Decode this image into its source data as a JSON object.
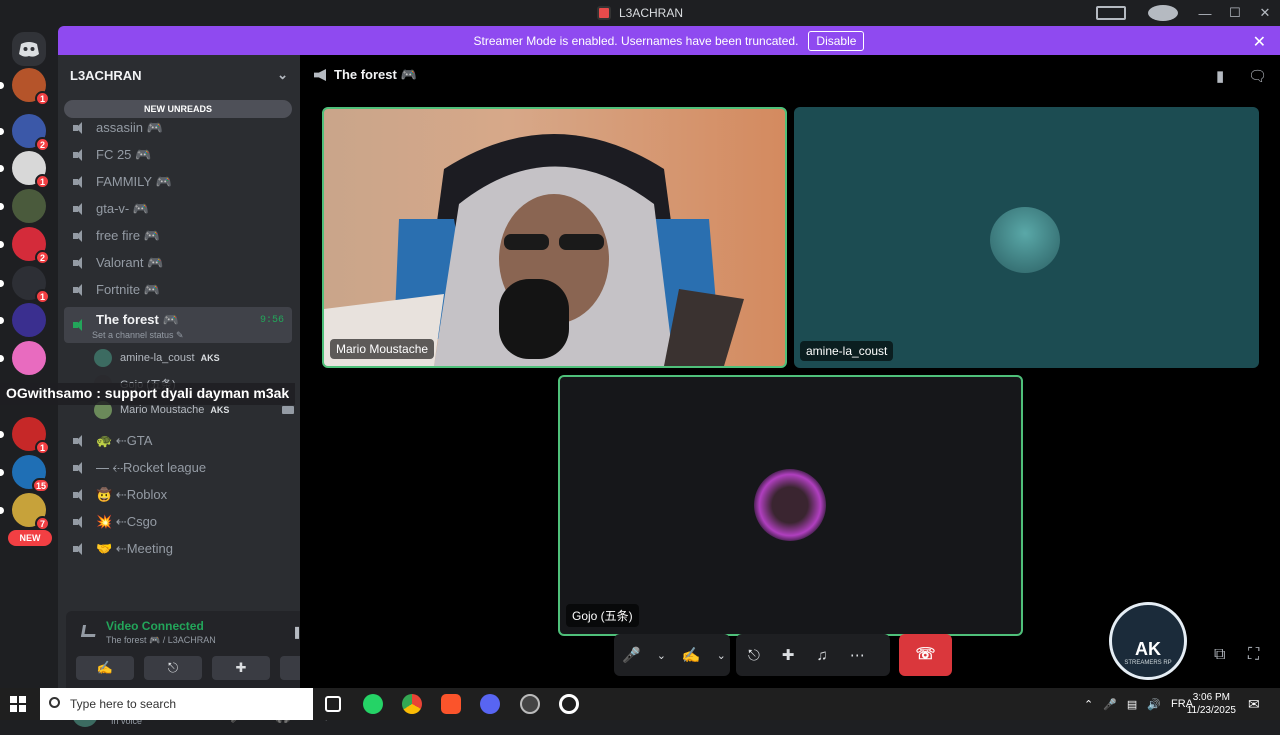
{
  "window": {
    "title": "L3ACHRAN"
  },
  "banner": {
    "text": "Streamer Mode is enabled. Usernames have been truncated.",
    "disable_label": "Disable"
  },
  "servers": [
    {
      "badge": "1",
      "color": "#b5542a"
    },
    {
      "badge": "2",
      "color": "#3b58a8"
    },
    {
      "badge": "1",
      "color": "#d8d8d8"
    },
    {
      "badge": "",
      "color": "#4a5a3c"
    },
    {
      "badge": "2",
      "color": "#d42b3a"
    },
    {
      "badge": "1",
      "color": "#2d2f35"
    },
    {
      "badge": "",
      "color": "#3a2f8f"
    },
    {
      "badge": "",
      "color": "#e86bbf"
    },
    {
      "badge": "1",
      "color": "#c62828"
    },
    {
      "badge": "15",
      "color": "#1f6fb5"
    },
    {
      "badge": "7",
      "color": "#c7a23a"
    }
  ],
  "new_label": "NEW",
  "sidebar": {
    "guild_name": "L3ACHRAN",
    "new_unreads": "NEW UNREADS",
    "channels": [
      {
        "name": "assasiin 🎮"
      },
      {
        "name": "FC 25 🎮"
      },
      {
        "name": "FAMMILY 🎮"
      },
      {
        "name": "gta-v- 🎮"
      },
      {
        "name": "free fire 🎮"
      },
      {
        "name": "Valorant 🎮"
      },
      {
        "name": "Fortnite 🎮"
      }
    ],
    "active_channel": {
      "name": "The forest 🎮",
      "timer": "9:56",
      "status": "Set a channel status ✎"
    },
    "members": [
      {
        "name": "amine-la_coust",
        "tag": "AKS"
      },
      {
        "name": "Gojo (五条)",
        "tag": ""
      },
      {
        "name": "Mario Moustache",
        "tag": "AKS"
      }
    ],
    "more_channels": [
      {
        "name": "🐢 ⇠GTA"
      },
      {
        "name": "⎯⎯ ⇠Rocket league"
      },
      {
        "name": "🤠 ⇠Roblox"
      },
      {
        "name": "💥 ⇠Csgo"
      },
      {
        "name": "🤝 ⇠Meeting"
      }
    ]
  },
  "overlay_message": "OGwithsamo : support dyali dayman m3ak",
  "voice_panel": {
    "title": "Video Connected",
    "subtitle": "The forest 🎮 / L3ACHRAN"
  },
  "user": {
    "name": "amine-la_coust",
    "status": "In voice"
  },
  "stage": {
    "channel_name": "The forest 🎮",
    "tiles": [
      {
        "label": "Mario Moustache"
      },
      {
        "label": "amine-la_coust"
      },
      {
        "label": "Gojo (五条)"
      }
    ]
  },
  "watermark": {
    "text": "AK",
    "sub": "STREAMERS RP"
  },
  "taskbar": {
    "search_placeholder": "Type here to search",
    "language": "FRA",
    "time": "3:06 PM",
    "date": "11/23/2025"
  },
  "colors": {
    "accent": "#8f4af0",
    "speaking": "#4fc07a",
    "danger": "#da373c",
    "online": "#23a55a"
  }
}
